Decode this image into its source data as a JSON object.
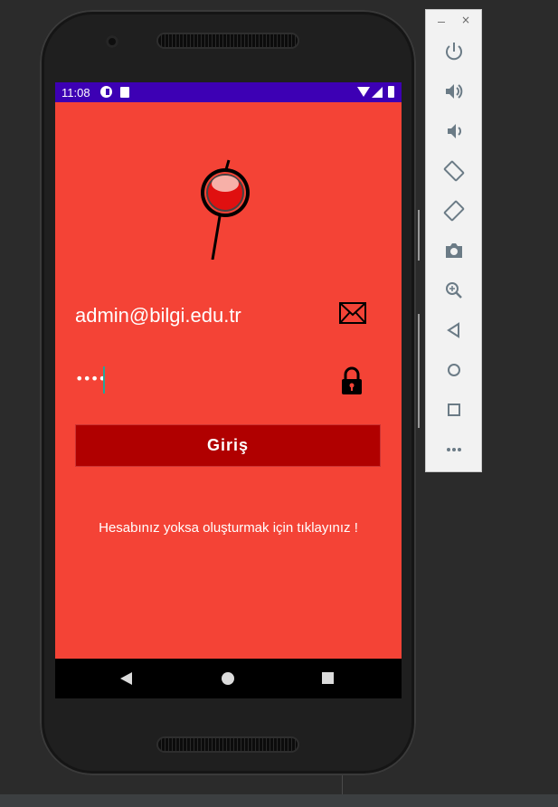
{
  "status_bar": {
    "time": "11:08"
  },
  "login": {
    "email_value": "admin@bilgi.edu.tr",
    "password_value": "••••",
    "login_button": "Giriş",
    "register_link": "Hesabınız yoksa oluşturmak için tıklayınız !"
  },
  "colors": {
    "background": "#f44336",
    "button": "#b00000",
    "status_bar": "#3d00b4"
  },
  "emulator_toolbar": {
    "window_controls": [
      "minimize-icon",
      "close-icon"
    ],
    "close_glyph": "×",
    "buttons": [
      "power-icon",
      "volume-up-icon",
      "volume-down-icon",
      "rotate-left-icon",
      "rotate-right-icon",
      "camera-icon",
      "zoom-icon",
      "back-icon",
      "home-icon",
      "overview-icon",
      "more-icon"
    ]
  },
  "nav_bar": {
    "buttons": [
      "back-icon",
      "home-icon",
      "recents-icon"
    ]
  }
}
